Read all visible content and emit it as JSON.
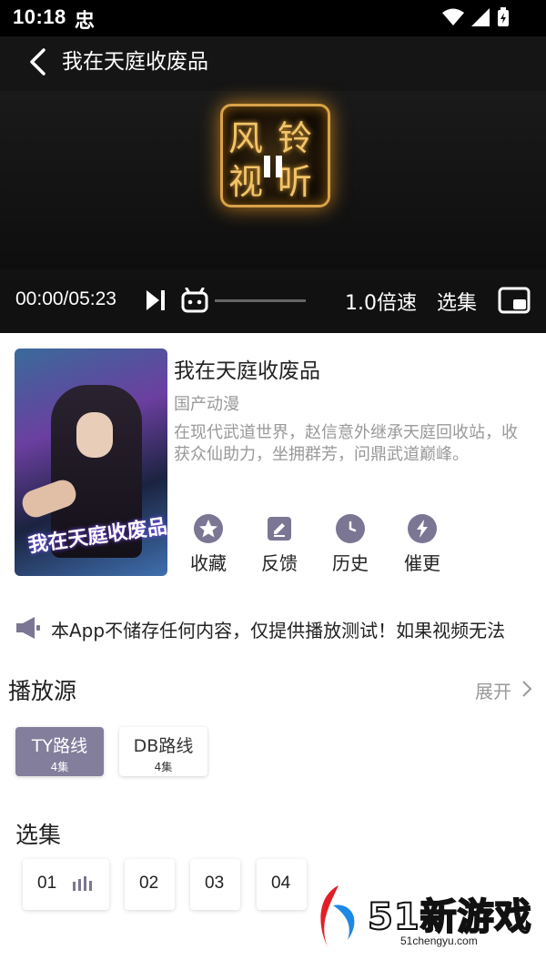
{
  "status_bar": {
    "time": "10:18",
    "notif_glyph": "忠"
  },
  "video": {
    "title": "我在天庭收废品",
    "logo_chars": [
      "风",
      "铃",
      "视",
      "听"
    ],
    "time": "00:00/05:23",
    "speed": "1.0倍速",
    "episodes_label": "选集",
    "progress": 0
  },
  "anime": {
    "poster_title": "我在天庭收废品",
    "title": "我在天庭收废品",
    "type": "国产动漫",
    "description": "在现代武道世界，赵信意外继承天庭回收站，收获众仙助力，坐拥群芳，问鼎武道巅峰。"
  },
  "actions": [
    {
      "label": "收藏",
      "icon": "star-icon"
    },
    {
      "label": "反馈",
      "icon": "edit-icon"
    },
    {
      "label": "历史",
      "icon": "clock-icon"
    },
    {
      "label": "催更",
      "icon": "bolt-icon"
    }
  ],
  "notice": {
    "text": "本App不储存任何内容，仅提供播放测试！如果视频无法"
  },
  "sources": {
    "title": "播放源",
    "expand_label": "展开",
    "routes": [
      {
        "name": "TY路线",
        "count": "4集",
        "active": true
      },
      {
        "name": "DB路线",
        "count": "4集",
        "active": false
      }
    ]
  },
  "episodes": {
    "title": "选集",
    "items": [
      "01",
      "02",
      "03",
      "04"
    ]
  },
  "watermark": {
    "text": "51新游戏",
    "url": "51chengyu.com"
  },
  "colors": {
    "accent": "#837e9c",
    "icon_bg": "#7b7694"
  }
}
